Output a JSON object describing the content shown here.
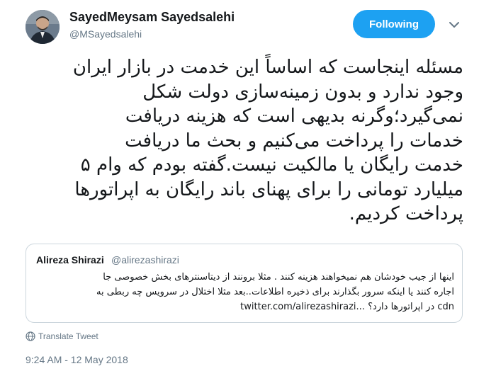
{
  "author": {
    "display_name": "SayedMeysam Sayedsalehi",
    "handle": "@MSayedsalehi",
    "avatar_icon": "profile-photo"
  },
  "follow_button": {
    "label": "Following",
    "color": "#1da1f2"
  },
  "menu": {
    "icon": "chevron-down-icon"
  },
  "tweet": {
    "lines": [
      "مسئله اینجاست که اساساً این خدمت در بازار ایران",
      "وجود ندارد و بدون زمینه‌سازی دولت شکل",
      "نمی‌گیرد؛وگرنه بدیهی است که هزینه دریافت",
      "خدمات را پرداخت می‌کنیم و بحث ما دریافت",
      "خدمت رایگان یا مالکیت نیست.گفته بودم که وام ۵",
      "میلیارد تومانی را برای پهنای باند رایگان به اپراتورها",
      "پرداخت کردیم."
    ]
  },
  "quoted_tweet": {
    "display_name": "Alireza Shirazi",
    "handle": "@alirezashirazi",
    "lines": [
      "اینها از جیب خودشان هم نمیخواهند هزینه کنند . مثلا برونند از دیتاسنترهای بخش خصوصی جا",
      "اجاره کنند یا اینکه سرور بگذارند برای ذخیره اطلاعات..بعد مثلا اختلال در سرویس چه ربطی به",
      "cdn  در اپراتورها دارد؟ ...twitter.com/alirezashirazi"
    ]
  },
  "translate": {
    "label": "Translate Tweet",
    "icon": "globe-icon"
  },
  "timestamp": "9:24 AM - 12 May 2018"
}
